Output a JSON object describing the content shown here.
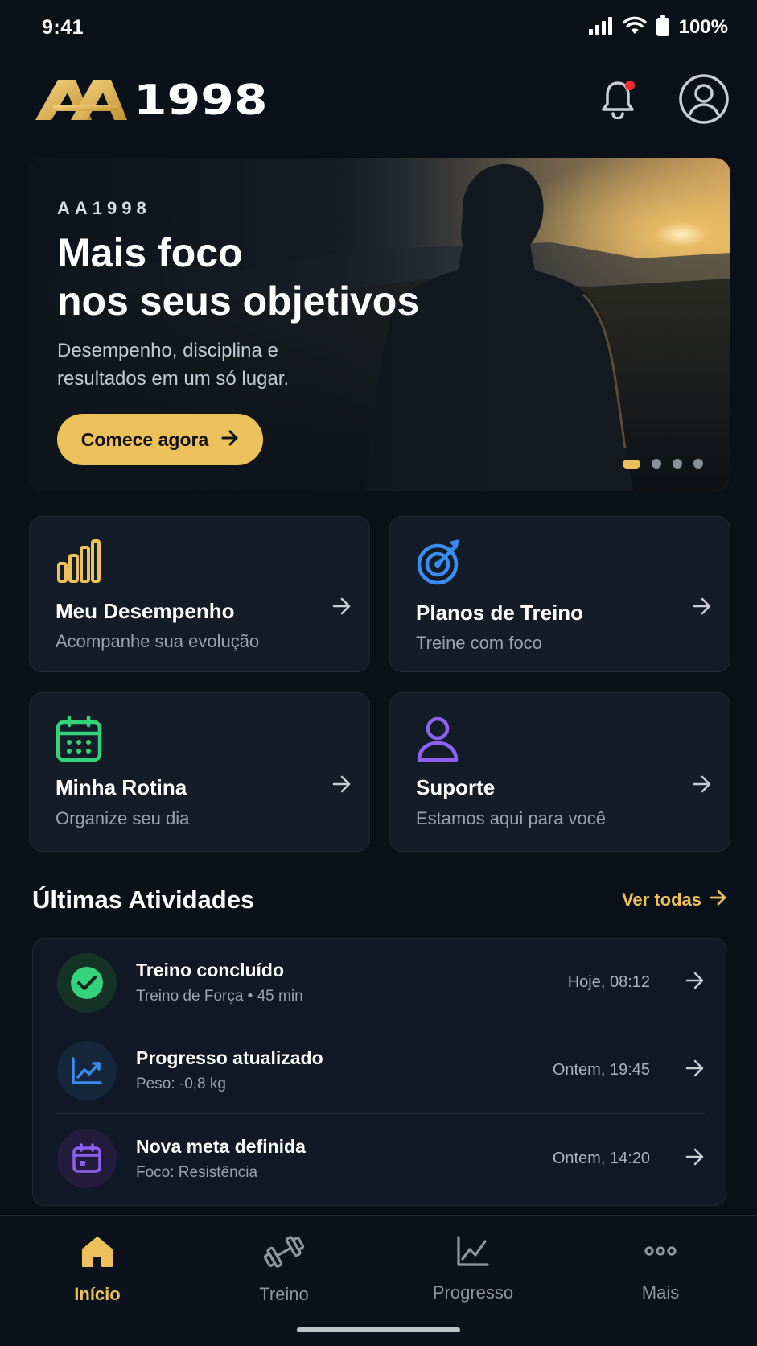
{
  "status_bar": {
    "time": "9:41",
    "battery": "100%"
  },
  "header": {
    "logo_text": "1998"
  },
  "hero": {
    "brand": "AA1998",
    "title": "Mais foco\nnos seus objetivos",
    "subtitle": "Desempenho, disciplina e\nresultados em um só lugar.",
    "cta_label": "Comece agora",
    "slides_total": 4,
    "active_slide": 1
  },
  "cards": [
    {
      "title": "Meu Desempenho",
      "subtitle": "Acompanhe sua evolução",
      "icon": "bar-chart-icon",
      "color": "#ecc05a"
    },
    {
      "title": "Planos de Treino",
      "subtitle": "Treine com foco",
      "icon": "target-icon",
      "color": "#3b8cf2"
    },
    {
      "title": "Minha Rotina",
      "subtitle": "Organize seu dia",
      "icon": "calendar-icon",
      "color": "#34d27a"
    },
    {
      "title": "Suporte",
      "subtitle": "Estamos aqui para você",
      "icon": "user-icon",
      "color": "#8e62f0"
    }
  ],
  "activities_section": {
    "title": "Últimas Atividades",
    "see_all": "Ver todas"
  },
  "activities": [
    {
      "title": "Treino concluído",
      "subtitle": "Treino de Força • 45 min",
      "time": "Hoje, 08:12",
      "icon": "check-circle-icon",
      "color": "#34d27a"
    },
    {
      "title": "Progresso atualizado",
      "subtitle": "Peso: -0,8 kg",
      "time": "Ontem, 19:45",
      "icon": "trend-chart-icon",
      "color": "#3b8cf2"
    },
    {
      "title": "Nova meta definida",
      "subtitle": "Foco: Resistência",
      "time": "Ontem, 14:20",
      "icon": "calendar-icon",
      "color": "#8e62f0"
    }
  ],
  "bottom_nav": [
    {
      "label": "Início",
      "icon": "home-icon",
      "active": true
    },
    {
      "label": "Treino",
      "icon": "dumbbell-icon",
      "active": false
    },
    {
      "label": "Progresso",
      "icon": "chart-icon",
      "active": false
    },
    {
      "label": "Mais",
      "icon": "more-icon",
      "active": false
    }
  ],
  "colors": {
    "accent": "#ecc05a",
    "background": "#0b1119",
    "card": "#141c28"
  }
}
